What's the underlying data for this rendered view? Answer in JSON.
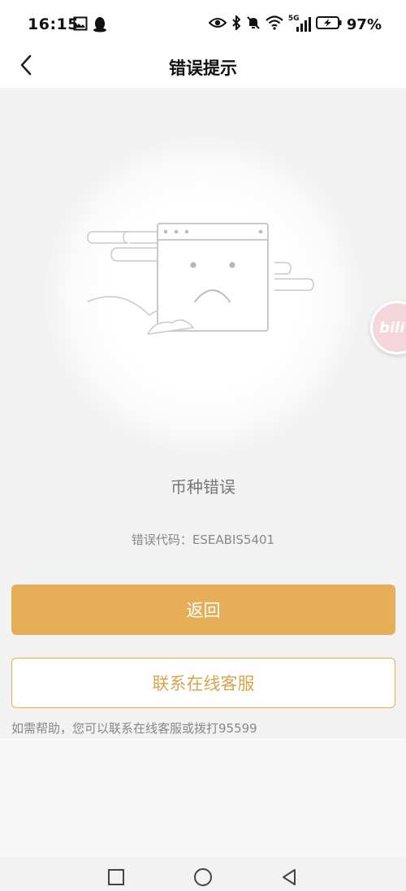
{
  "status_bar": {
    "time": "16:15",
    "battery": "97%",
    "network": "5G",
    "left_icons": [
      "image-icon",
      "qq-penguin-icon"
    ],
    "right_icons": [
      "eye-icon",
      "bluetooth-icon",
      "mute-icon",
      "wifi-icon",
      "signal-icon",
      "battery-icon"
    ]
  },
  "header": {
    "title": "错误提示",
    "back_icon": "chevron-left-icon"
  },
  "error": {
    "title": "币种错误",
    "code": "错误代码：ESEABIS5401"
  },
  "buttons": {
    "back_label": "返回",
    "customer_service_label": "联系在线客服"
  },
  "help_text": "如需帮助，您可以联系在线客服或拨打95599",
  "floating": {
    "label": "bili"
  },
  "colors": {
    "accent": "#e6ae57",
    "accent_text": "#d9a44f",
    "background": "#f2f2f2"
  },
  "nav": [
    "recents-square-icon",
    "home-circle-icon",
    "back-triangle-icon"
  ]
}
